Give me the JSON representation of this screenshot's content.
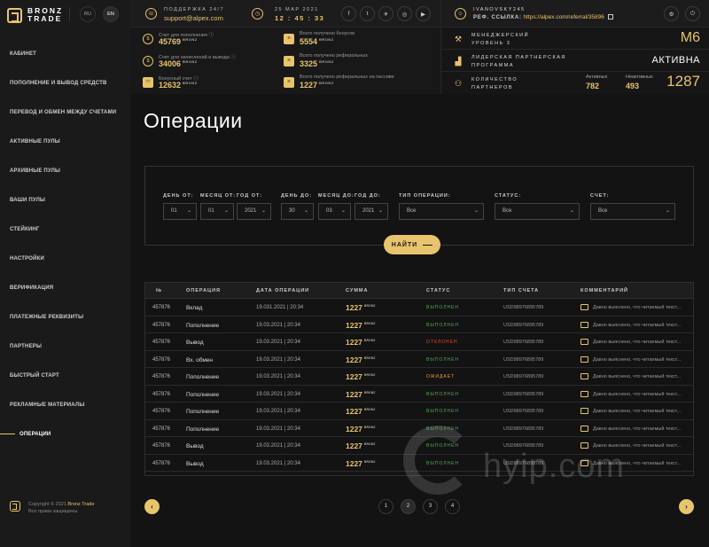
{
  "brand": {
    "line1": "BRONZ",
    "line2": "TRADE"
  },
  "languages": [
    "RU",
    "EN"
  ],
  "nav": [
    "КАБИНЕТ",
    "ПОПОЛНЕНИЕ И ВЫВОД СРЕДСТВ",
    "ПЕРЕВОД И ОБМЕН МЕЖДУ СЧЕТАМИ",
    "АКТИВНЫЕ ПУЛЫ",
    "АРХИВНЫЕ ПУЛЫ",
    "ВАШИ ПУЛЫ",
    "СТЕЙКИНГ",
    "НАСТРОЙКИ",
    "ВЕРИФИКАЦИЯ",
    "ПЛАТЕЖНЫЕ РЕКВИЗИТЫ",
    "ПАРТНЕРЫ",
    "БЫСТРЫЙ СТАРТ",
    "РЕКЛАМНЫЕ МАТЕРИАЛЫ",
    "ОПЕРАЦИИ"
  ],
  "active_nav": "ОПЕРАЦИИ",
  "footer": {
    "prefix": "Copyright © 2021",
    "brand": "Bronz Trade",
    "rights": "Все права защищены."
  },
  "support": {
    "label": "ПОДДЕРЖКА 24/7",
    "email": "support@alpex.com"
  },
  "datetime": {
    "date": "25 МАР 2021",
    "time": "12 : 45 : 33"
  },
  "socials": [
    "f",
    "t",
    "✈",
    "◎",
    "▶"
  ],
  "user": {
    "name": "IVANOVSKY245",
    "ref_label": "РЕФ. ССЫЛКА:",
    "ref_link": "https://alpex.com/referral/35896"
  },
  "stats": [
    {
      "label": "Счет для пополнения",
      "value": "45769",
      "currency": "BRONZ"
    },
    {
      "label": "Всего получено бонусов",
      "value": "5554",
      "currency": "BRONZ"
    },
    {
      "label": "Счет для начислений и вывода",
      "value": "34006",
      "currency": "BRONZ"
    },
    {
      "label": "Всего получено реферальных",
      "value": "3325",
      "currency": "BRONZ"
    },
    {
      "label": "Бонусный счет",
      "value": "12632",
      "currency": "BRONZ"
    },
    {
      "label": "Всего получено реферальных на пассиве",
      "value": "1227",
      "currency": "BRONZ"
    }
  ],
  "manager": {
    "label1": "МЕНЕДЖЕРСКИЙ",
    "label2": "УРОВЕНЬ 3",
    "value": "M6"
  },
  "leader": {
    "label1": "ЛИДЕРСКАЯ ПАРТНЕРСКАЯ",
    "label2": "ПРОГРАММА",
    "value": "АКТИВНА"
  },
  "partners": {
    "label1": "КОЛИЧЕСТВО",
    "label2": "ПАРТНЕРОВ",
    "active_label": "Активных",
    "active": "782",
    "inactive_label": "Неактивных",
    "inactive": "493",
    "total": "1287"
  },
  "page_title": "Операции",
  "filters": {
    "day_from": {
      "label": "ДЕНЬ ОТ:",
      "value": "01"
    },
    "month_from": {
      "label": "МЕСЯЦ ОТ:",
      "value": "01"
    },
    "year_from": {
      "label": "ГОД ОТ:",
      "value": "2021"
    },
    "day_to": {
      "label": "ДЕНЬ ДО:",
      "value": "30"
    },
    "month_to": {
      "label": "МЕСЯЦ ДО:",
      "value": "03"
    },
    "year_to": {
      "label": "ГОД ДО:",
      "value": "2021"
    },
    "op_type": {
      "label": "ТИП ОПЕРАЦИИ:",
      "value": "Все"
    },
    "status": {
      "label": "СТАТУС:",
      "value": "Все"
    },
    "account": {
      "label": "СЧЕТ:",
      "value": "Все"
    },
    "button": "НАЙТИ"
  },
  "table": {
    "headers": [
      "№",
      "ОПЕРАЦИЯ",
      "ДАТА ОПЕРАЦИИ",
      "СУММА",
      "СТАТУС",
      "ТИП СЧЕТА",
      "КОММЕНТАРИЙ"
    ],
    "rows": [
      {
        "id": "457876",
        "op": "Вклад",
        "date": "19.031.2021 | 20:34",
        "amount": "1227",
        "currency": "BRONZ",
        "status": "ВЫПОЛНЕН",
        "status_color": "#4caf50",
        "account": "USD98976895789",
        "comment": "Давно выяснено, что читаемый текст..."
      },
      {
        "id": "457876",
        "op": "Пополнение",
        "date": "19.03.2021 | 20:34",
        "amount": "1227",
        "currency": "BRONZ",
        "status": "ВЫПОЛНЕН",
        "status_color": "#4caf50",
        "account": "USD98976895789",
        "comment": "Давно выяснено, что читаемый текст..."
      },
      {
        "id": "457876",
        "op": "Вывод",
        "date": "19.03.2021 | 20:34",
        "amount": "1227",
        "currency": "BRONZ",
        "status": "ОТКЛОНЕН",
        "status_color": "#e04b3c",
        "account": "USD98976895789",
        "comment": "Давно выяснено, что читаемый текст..."
      },
      {
        "id": "457876",
        "op": "Вх. обмен",
        "date": "19.03.2021 | 20:34",
        "amount": "1227",
        "currency": "BRONZ",
        "status": "ВЫПОЛНЕН",
        "status_color": "#4caf50",
        "account": "USD98976895789",
        "comment": "Давно выяснено, что читаемый текст..."
      },
      {
        "id": "457876",
        "op": "Пополнение",
        "date": "19.03.2021 | 20:34",
        "amount": "1227",
        "currency": "BRONZ",
        "status": "ОЖИДАЕТ",
        "status_color": "#e8a53c",
        "account": "USD98976895789",
        "comment": "Давно выяснено, что читаемый текст..."
      },
      {
        "id": "457876",
        "op": "Пополнение",
        "date": "19.03.2021 | 20:34",
        "amount": "1227",
        "currency": "BRONZ",
        "status": "ВЫПОЛНЕН",
        "status_color": "#4caf50",
        "account": "USD98976895789",
        "comment": "Давно выяснено, что читаемый текст..."
      },
      {
        "id": "457876",
        "op": "Пополнение",
        "date": "19.03.2021 | 20:34",
        "amount": "1227",
        "currency": "BRONZ",
        "status": "ВЫПОЛНЕН",
        "status_color": "#4caf50",
        "account": "USD98976895789",
        "comment": "Давно выяснено, что читаемый текст..."
      },
      {
        "id": "457876",
        "op": "Пополнение",
        "date": "19.03.2021 | 20:34",
        "amount": "1227",
        "currency": "BRONZ",
        "status": "ВЫПОЛНЕН",
        "status_color": "#4caf50",
        "account": "USD98976895789",
        "comment": "Давно выяснено, что читаемый текст..."
      },
      {
        "id": "457876",
        "op": "Вывод",
        "date": "19.03.2021 | 20:34",
        "amount": "1227",
        "currency": "BRONZ",
        "status": "ВЫПОЛНЕН",
        "status_color": "#4caf50",
        "account": "USD98976895789",
        "comment": "Давно выяснено, что читаемый текст..."
      },
      {
        "id": "457876",
        "op": "Вывод",
        "date": "19.03.2021 | 20:34",
        "amount": "1227",
        "currency": "BRONZ",
        "status": "ВЫПОЛНЕН",
        "status_color": "#4caf50",
        "account": "USD98976895789",
        "comment": "Давно выяснено, что читаемый текст..."
      }
    ]
  },
  "pagination": {
    "pages": [
      "1",
      "2",
      "3",
      "4"
    ],
    "current": "2",
    "prev": "‹",
    "next": "›"
  },
  "watermark": "hyip.com",
  "colors": {
    "accent": "#e8c46c",
    "background": "#131313",
    "sidebar": "#1a1a1a"
  },
  "icons": {
    "support": "headset-icon",
    "clock": "clock-icon",
    "user": "user-icon",
    "settings": "gear-icon",
    "logout": "power-icon",
    "copy": "copy-icon"
  }
}
